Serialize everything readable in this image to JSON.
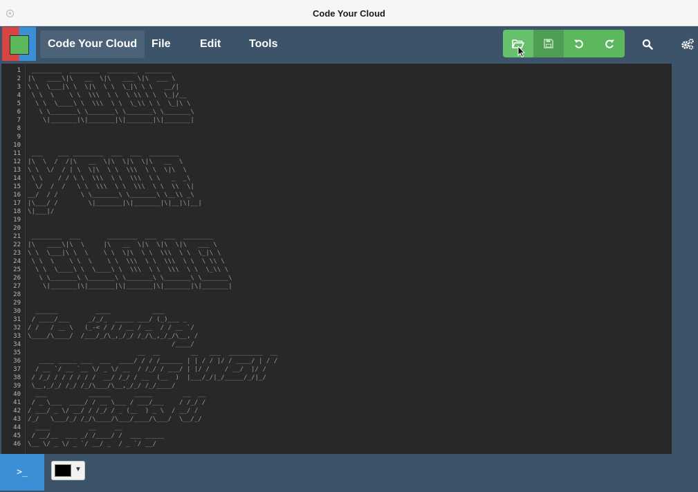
{
  "window": {
    "title": "Code Your Cloud"
  },
  "menu": {
    "app_name": "Code Your Cloud",
    "items": [
      {
        "label": "File"
      },
      {
        "label": "Edit"
      },
      {
        "label": "Tools"
      }
    ]
  },
  "toolbar": {
    "buttons": [
      {
        "icon": "folder-open-icon",
        "enabled": true
      },
      {
        "icon": "save-icon",
        "enabled": false
      },
      {
        "icon": "undo-icon",
        "enabled": true
      },
      {
        "icon": "redo-icon",
        "enabled": true
      }
    ],
    "search_icon": "search-icon",
    "settings_icon": "gears-icon"
  },
  "editor": {
    "line_count": 46,
    "lines": [
      " ________  ________  ________  _______",
      "|\\   ____\\|\\   __  \\|\\   ___ \\|\\  ___ \\",
      "\\ \\  \\___|\\ \\  \\|\\  \\ \\  \\_|\\ \\ \\   __/|",
      " \\ \\  \\    \\ \\  \\\\\\  \\ \\  \\ \\\\ \\ \\  \\_|/__",
      "  \\ \\  \\____\\ \\  \\\\\\  \\ \\  \\_\\\\ \\ \\  \\_|\\ \\",
      "   \\ \\_______\\ \\_______\\ \\_______\\ \\_______\\",
      "    \\|_______|\\|_______|\\|_______|\\|_______|",
      "",
      "",
      "",
      " ___    ___ ________  ___  ___  ________",
      "|\\  \\  /  /|\\   __  \\|\\  \\|\\  \\|\\   __  \\",
      "\\ \\  \\/  / | \\  \\|\\  \\ \\  \\\\\\  \\ \\  \\|\\  \\",
      " \\ \\    / / \\ \\  \\\\\\  \\ \\  \\\\\\  \\ \\   _  _\\",
      "  \\/  /  /   \\ \\  \\\\\\  \\ \\  \\\\\\  \\ \\  \\\\  \\|",
      "__/  / /      \\ \\_______\\ \\_______\\ \\__\\\\ _\\",
      "|\\___/ /        \\|_______|\\|_______|\\|__|\\|__|",
      "\\|___|/",
      "",
      "",
      " ________  ___       ________  ___  ___  ________",
      "|\\   ____\\|\\  \\     |\\   __  \\|\\  \\|\\  \\|\\   ___ \\",
      "\\ \\  \\___|\\ \\  \\    \\ \\  \\|\\  \\ \\  \\\\\\  \\ \\  \\_|\\ \\",
      " \\ \\  \\    \\ \\  \\    \\ \\  \\\\\\  \\ \\  \\\\\\  \\ \\  \\ \\\\ \\",
      "  \\ \\  \\____\\ \\  \\____\\ \\  \\\\\\  \\ \\  \\\\\\  \\ \\  \\_\\\\ \\",
      "   \\ \\_______\\ \\_______\\ \\_______\\ \\_______\\ \\_______\\",
      "    \\|_______|\\|_______|\\|_______|\\|_______|\\|_______|",
      "",
      "",
      "  ______          ____           ___",
      " / ____/___     _/_/_  _____ ___/ (_)___ _",
      "/ /   / __ \\   (_-< / / / __ / __  / / __ `/",
      "\\____/\\____/  /___/_/\\_,_/_/ /_/\\_,_/_/\\__, /",
      "                                      /____/",
      "                             __  __        __   ___  _________  __",
      "   ____ _____ ___  ___  ____/ / / /______ | | / / |/ / ____/ | / /",
      "  / __ `/ __ `__ \\/ _ \\/ __  / /_/ / ___/ | |/ /    / __/  |/ /",
      " / /_/ / / / / / /  __/ /_/ / __  (__  )  |___/_/|_/_____/_/|_/",
      " \\__,_/_/ /_/ /_/\\___/\\__,_/_/ /_/____/",
      "  ___           ______      _____        __  __",
      " / _ \\___  ____/ / __ \\___ / ___/___    / /_/ /",
      "/ ___/ _ \\/ __/ / /_/ / _ (__  ) _ \\  / __/ /",
      "/_/   \\___/_/ /_/\\____/\\___/____/\\___/  \\__/_/",
      "  ____          __     __",
      " / __/__  ___ _/ /____/ /  ___ _____",
      "\\__ \\/ _ \\/ _ `/ __/ _  / _ `/ __/",
      ""
    ]
  },
  "bottom": {
    "terminal_label": ">_",
    "color_value": "#000000"
  }
}
